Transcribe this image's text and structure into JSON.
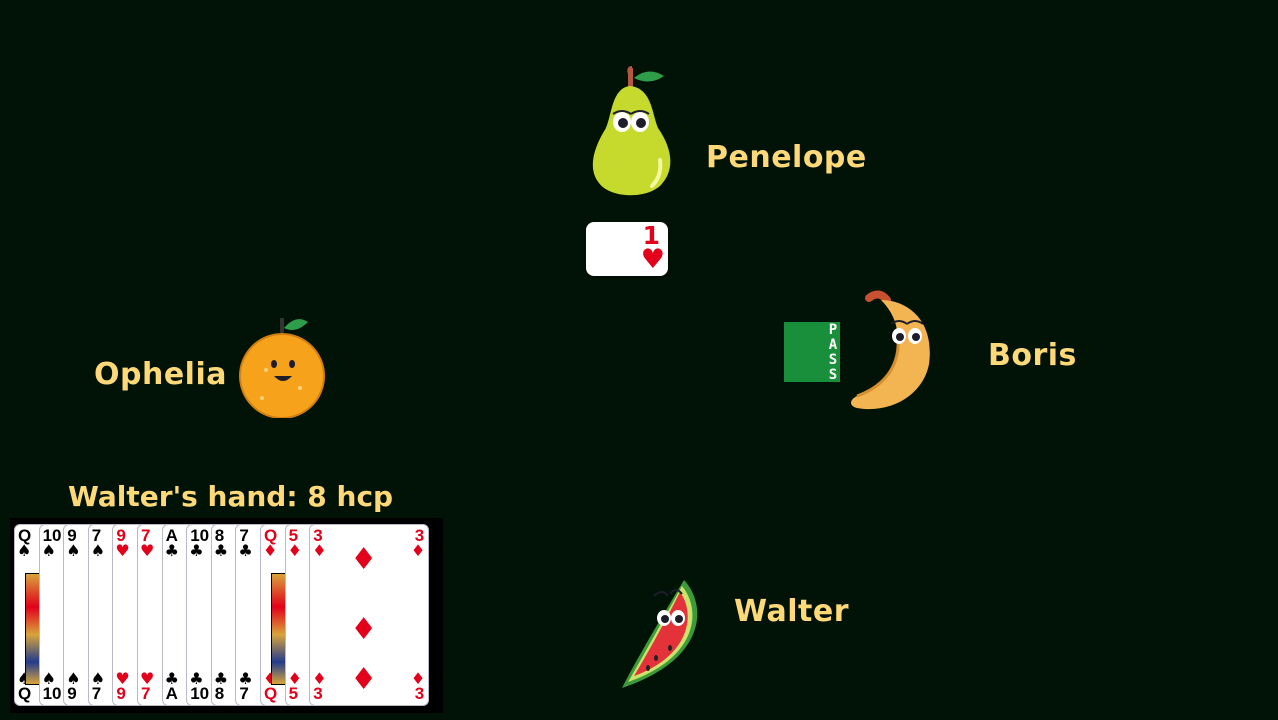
{
  "players": {
    "north": {
      "name": "Penelope",
      "avatar": "pear"
    },
    "east": {
      "name": "Boris",
      "avatar": "banana"
    },
    "west": {
      "name": "Ophelia",
      "avatar": "orange"
    },
    "south": {
      "name": "Walter",
      "avatar": "watermelon"
    }
  },
  "bids": {
    "north": {
      "level": "1",
      "suit": "♥",
      "suit_name": "hearts"
    },
    "east": {
      "text": "PASS"
    }
  },
  "hand": {
    "title": "Walter's hand: 8 hcp",
    "cards": [
      {
        "rank": "Q",
        "suit": "♠",
        "color": "black"
      },
      {
        "rank": "10",
        "suit": "♠",
        "color": "black"
      },
      {
        "rank": "9",
        "suit": "♠",
        "color": "black"
      },
      {
        "rank": "7",
        "suit": "♠",
        "color": "black"
      },
      {
        "rank": "9",
        "suit": "♥",
        "color": "red"
      },
      {
        "rank": "7",
        "suit": "♥",
        "color": "red"
      },
      {
        "rank": "A",
        "suit": "♣",
        "color": "black"
      },
      {
        "rank": "10",
        "suit": "♣",
        "color": "black"
      },
      {
        "rank": "8",
        "suit": "♣",
        "color": "black"
      },
      {
        "rank": "7",
        "suit": "♣",
        "color": "black"
      },
      {
        "rank": "Q",
        "suit": "♦",
        "color": "red"
      },
      {
        "rank": "5",
        "suit": "♦",
        "color": "red"
      },
      {
        "rank": "3",
        "suit": "♦",
        "color": "red"
      }
    ]
  },
  "colors": {
    "background": "#001306",
    "name_text": "#ffd978",
    "pass_green": "#1a8f3b",
    "heart_red": "#e2001a"
  }
}
